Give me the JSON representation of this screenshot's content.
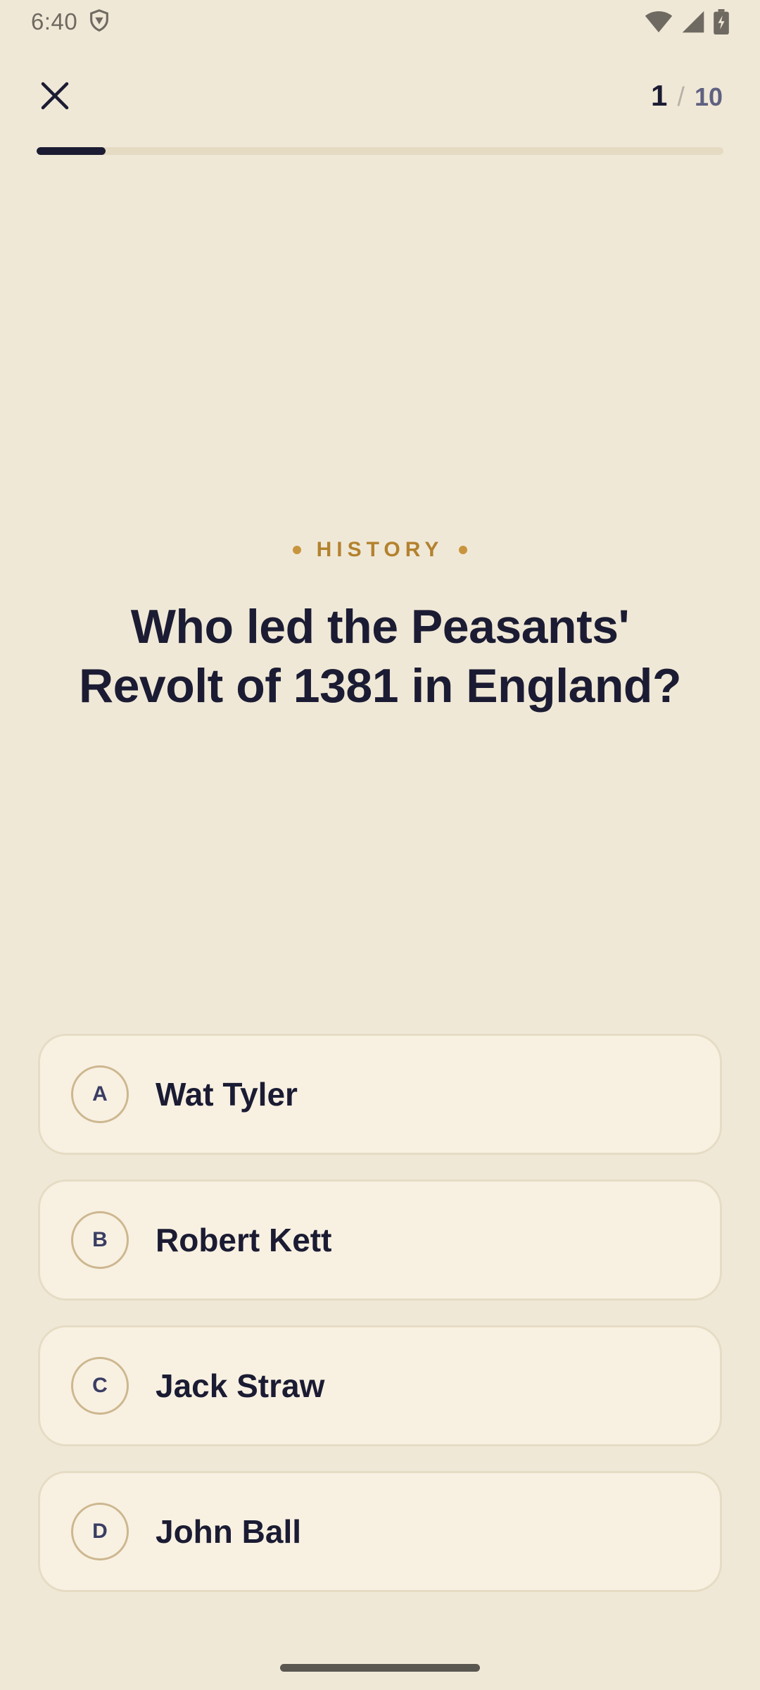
{
  "status_bar": {
    "time": "6:40",
    "icons": [
      "vpn-shield-icon",
      "wifi-icon",
      "cell-signal-icon",
      "battery-charging-icon"
    ]
  },
  "header": {
    "close_icon": "close-icon",
    "counter_current": "1",
    "counter_separator": "/",
    "counter_total": "10",
    "progress_fraction": 0.1
  },
  "question": {
    "category": "HISTORY",
    "text": "Who led the Peasants' Revolt of 1381 in England?"
  },
  "options": [
    {
      "letter": "A",
      "text": "Wat Tyler"
    },
    {
      "letter": "B",
      "text": "Robert Kett"
    },
    {
      "letter": "C",
      "text": "Jack Straw"
    },
    {
      "letter": "D",
      "text": "John Ball"
    }
  ],
  "colors": {
    "background": "#f0e8d7",
    "accent": "#c8953e",
    "ink": "#1b1c33",
    "option_bg": "#f8f1e2"
  }
}
